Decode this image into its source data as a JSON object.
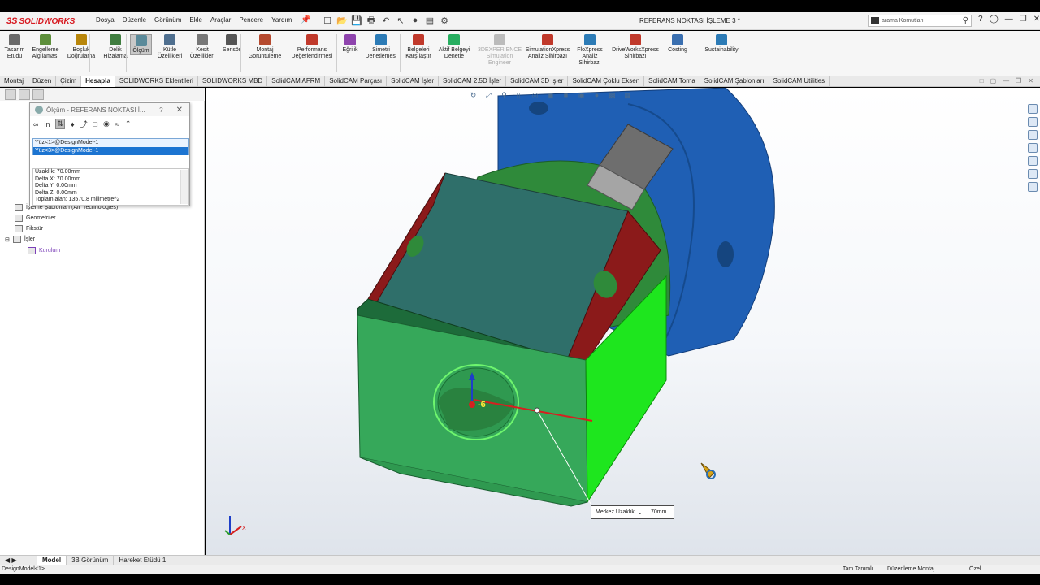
{
  "app": {
    "logo": "SOLIDWORKS",
    "logo_mark": "3S",
    "document_title": "REFERANS NOKTASI İŞLEME 3 *",
    "menu": [
      "Dosya",
      "Düzenle",
      "Görünüm",
      "Ekle",
      "Araçlar",
      "Pencere",
      "Yardım"
    ],
    "search_placeholder": "arama Komutları"
  },
  "command_manager": [
    {
      "label": "Tasarım\nEtüdü",
      "icon": "design-study-icon",
      "color": "#6b6b6b"
    },
    {
      "label": "Engelleme\nAlgılaması",
      "icon": "interference-icon",
      "color": "#5d8f3b"
    },
    {
      "label": "Boşluk\nDoğrulama",
      "icon": "clearance-icon",
      "color": "#b8860b"
    },
    {
      "label": "Delik\nHizalama",
      "icon": "hole-align-icon",
      "color": "#3f7d3f"
    },
    {
      "label": "Ölçüm",
      "icon": "measure-icon",
      "color": "#5a8a9a"
    },
    {
      "label": "Kütle\nÖzellikleri",
      "icon": "mass-properties-icon",
      "color": "#4f6f8f"
    },
    {
      "label": "Kesit\nÖzellikleri",
      "icon": "section-properties-icon",
      "color": "#777777"
    },
    {
      "label": "Sensör",
      "icon": "sensor-icon",
      "color": "#555555"
    },
    {
      "label": "Montaj\nGörüntüleme",
      "icon": "assembly-visualization-icon",
      "color": "#b54a2f"
    },
    {
      "label": "Performans\nDeğerlendirmesi",
      "icon": "performance-icon",
      "color": "#c0392b"
    },
    {
      "label": "Eğrilik",
      "icon": "curvature-icon",
      "color": "#8e44ad"
    },
    {
      "label": "Simetri\nDenetlemesi",
      "icon": "symmetry-icon",
      "color": "#2c7bb6"
    },
    {
      "label": "Belgeleri\nKarşılaştır",
      "icon": "compare-icon",
      "color": "#c0392b"
    },
    {
      "label": "Aktif Belgeyi\nDenetle",
      "icon": "check-document-icon",
      "color": "#27ae60"
    },
    {
      "label": "3DEXPERIENCE\nSimulation\nEngineer",
      "icon": "3dexperience-icon",
      "color": "#bbbbbb"
    },
    {
      "label": "SimulationXpress\nAnaliz Sihirbazı",
      "icon": "simulationxpress-icon",
      "color": "#c0392b"
    },
    {
      "label": "FloXpress\nAnaliz\nSihirbazı",
      "icon": "floxpress-icon",
      "color": "#2c7bb6"
    },
    {
      "label": "DriveWorksXpress\nSihirbazı",
      "icon": "driveworks-icon",
      "color": "#c0392b"
    },
    {
      "label": "Costing",
      "icon": "costing-icon",
      "color": "#3a6fb0"
    },
    {
      "label": "Sustainability",
      "icon": "sustainability-icon",
      "color": "#2c7bb6"
    }
  ],
  "tabs": [
    "Montaj",
    "Düzen",
    "Çizim",
    "Hesapla",
    "SOLIDWORKS Eklentileri",
    "SOLIDWORKS MBD",
    "SolidCAM AFRM",
    "SolidCAM Parçası",
    "SolidCAM İşler",
    "SolidCAM 2.5D İşler",
    "SolidCAM 3D İşler",
    "SolidCAM Çoklu Eksen",
    "SolidCAM Torna",
    "SolidCAM Şablonları",
    "SolidCAM Utilities"
  ],
  "active_tab": "Hesapla",
  "tree": [
    {
      "label": "İşleme Şablonları (All_Technologies)"
    },
    {
      "label": "Geometriler"
    },
    {
      "label": "Fikstür"
    },
    {
      "label": "İşler"
    },
    {
      "label": "Kurulum",
      "color": "#7b3fb8"
    }
  ],
  "measure": {
    "title": "Ölçüm - REFERANS NOKTASI İ...",
    "help": "?",
    "selections": [
      "Yüz<1>@DesignModel-1",
      "Yüz<3>@DesignModel-1"
    ],
    "results": [
      "Uzaklık: 70.00mm",
      "Delta X: 70.00mm",
      "Delta Y: 0.00mm",
      "Delta Z: 0.00mm",
      "Toplam alan: 13570.8 milimetre^2"
    ]
  },
  "viewport": {
    "dimension_label": "Merkez Uzaklık",
    "dimension_value": "70mm",
    "triad_label": "-6",
    "axis_x": "X"
  },
  "bottom_tabs": [
    "Model",
    "3B Görünüm",
    "Hareket Etüdü 1"
  ],
  "status": {
    "left": "DesignModel<1>",
    "definition": "Tam Tanımlı",
    "mode": "Düzenleme Montaj",
    "units": "Özel"
  }
}
